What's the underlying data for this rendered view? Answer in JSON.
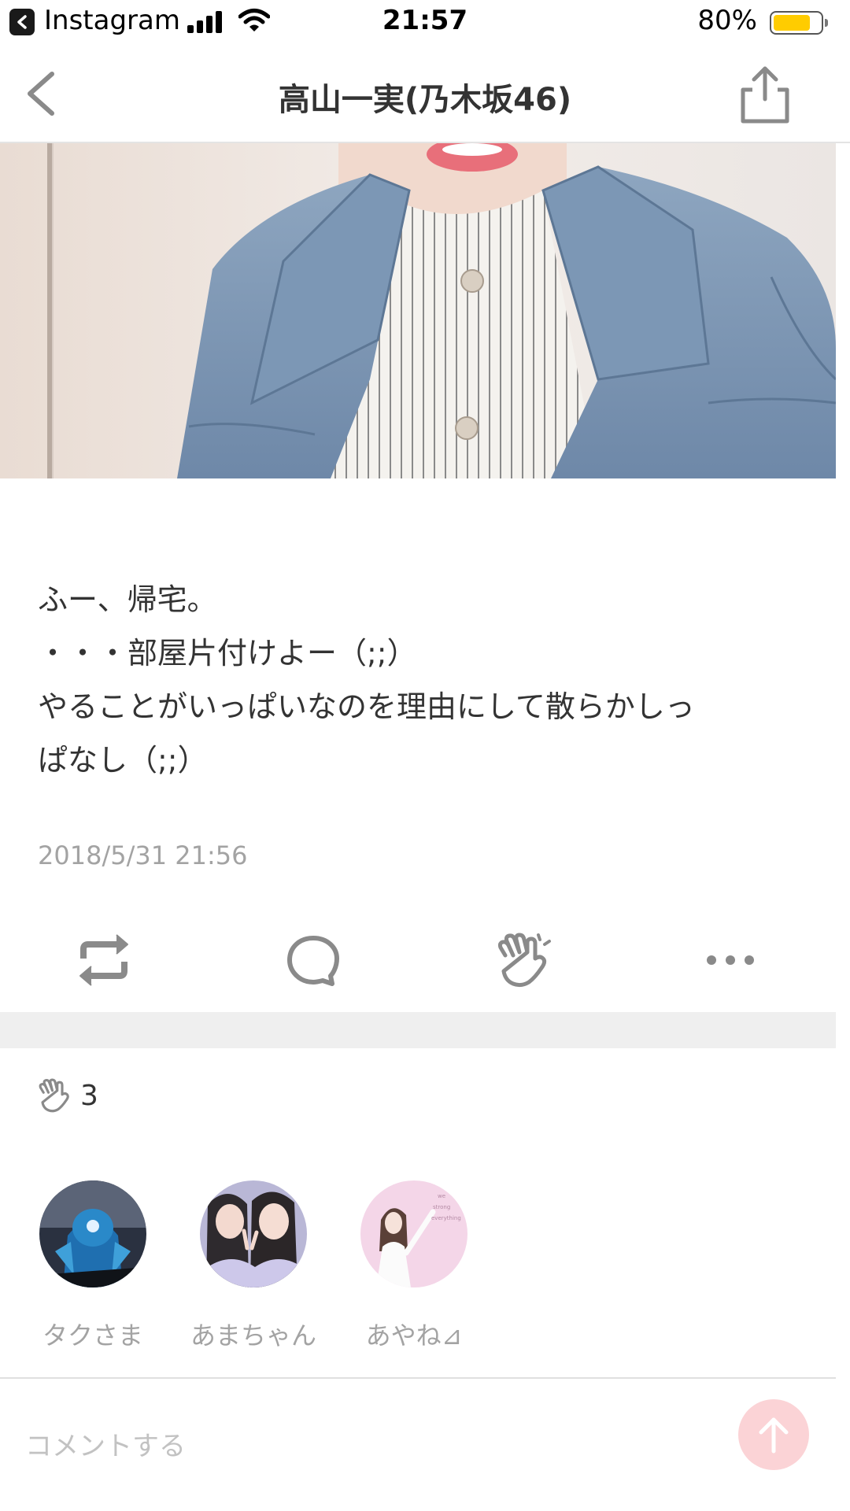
{
  "status_bar": {
    "back_app": "Instagram",
    "time": "21:57",
    "battery": "80%",
    "battery_level": 0.8,
    "battery_color": "#ffcc00"
  },
  "nav": {
    "title": "高山一実(乃木坂46)",
    "back_icon": "chevron-left-icon",
    "share_icon": "share-icon"
  },
  "post": {
    "lines": [
      "ふー、帰宅。",
      "・・・部屋片付けよー（;;）",
      "やることがいっぱいなのを理由にして散らかしっ",
      "ぱなし（;;）"
    ],
    "timestamp": "2018/5/31 21:56"
  },
  "actions": [
    {
      "name": "repost",
      "icon": "repost-icon"
    },
    {
      "name": "comment",
      "icon": "speech-bubble-icon"
    },
    {
      "name": "clap",
      "icon": "clap-icon"
    },
    {
      "name": "more",
      "icon": "more-icon"
    }
  ],
  "claps": {
    "icon": "clap-icon",
    "count": "3",
    "users": [
      {
        "name": "タクさま"
      },
      {
        "name": "あまちゃん"
      },
      {
        "name": "あやね⊿",
        "avatar_text": [
          "we",
          "strong",
          "everything"
        ]
      }
    ]
  },
  "comment": {
    "placeholder": "コメントする"
  },
  "colors": {
    "accent_light": "#fbd3d6",
    "muted_text": "#a3a3a3",
    "icon_gray": "#8a8a8a"
  }
}
